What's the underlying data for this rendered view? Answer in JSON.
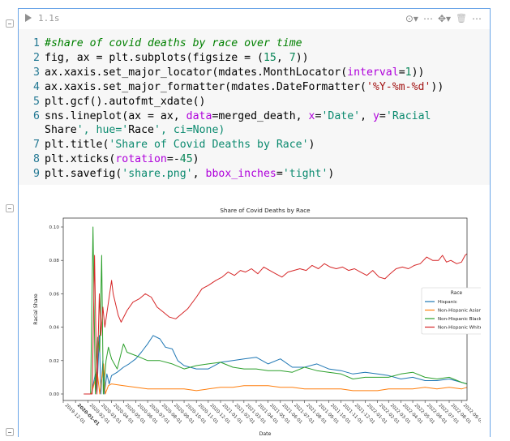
{
  "cell": {
    "execution_time": "1.1s",
    "toolbar_icons": [
      "eye-icon",
      "chevron-down-icon",
      "more-horizontal-icon",
      "puzzle-icon",
      "chevron-down-icon",
      "trash-icon",
      "more-vertical-icon"
    ],
    "toolbar": {
      "eye": "⊙▾",
      "more1": "⋯",
      "puzzle": "✥▾",
      "trash": "🗑",
      "more2": "⋯"
    }
  },
  "code": {
    "lines": [
      {
        "n": "1",
        "text": "#share of covid deaths by race over time"
      },
      {
        "n": "2",
        "text": "fig, ax = plt.subplots(figsize = (15, 7))"
      },
      {
        "n": "3",
        "text": "ax.xaxis.set_major_locator(mdates.MonthLocator(interval=1))"
      },
      {
        "n": "4",
        "text": "ax.xaxis.set_major_formatter(mdates.DateFormatter('%Y-%m-%d'))"
      },
      {
        "n": "5",
        "text": "plt.gcf().autofmt_xdate()"
      },
      {
        "n": "6",
        "text": "sns.lineplot(ax = ax, data=merged_death, x='Date', y='Racial"
      },
      {
        "n": "",
        "text": "Share', hue='Race', ci=None)"
      },
      {
        "n": "7",
        "text": "plt.title('Share of Covid Deaths by Race')"
      },
      {
        "n": "8",
        "text": "plt.xticks(rotation=-45)"
      },
      {
        "n": "9",
        "text": "plt.savefig('share.png', bbox_inches='tight')"
      }
    ]
  },
  "chart_data": {
    "type": "line",
    "title": "Share of Covid Deaths by Race",
    "xlabel": "Date",
    "ylabel": "Racial Share",
    "ylim": [
      0,
      0.1
    ],
    "yticks": [
      "0.00",
      "0.02",
      "0.04",
      "0.06",
      "0.08",
      "0.10"
    ],
    "ytick_values": [
      0,
      0.02,
      0.04,
      0.06,
      0.08,
      0.1
    ],
    "xlim": [
      "2019-12-01",
      "2022-09-15"
    ],
    "xticks": [
      "2019-12-01",
      "2020-01-01",
      "2020-02-01",
      "2020-03-01",
      "2020-04-01",
      "2020-05-01",
      "2020-06-01",
      "2020-07-01",
      "2020-08-01",
      "2020-09-01",
      "2020-10-01",
      "2020-11-01",
      "2020-12-01",
      "2021-01-01",
      "2021-02-01",
      "2021-03-01",
      "2021-04-01",
      "2021-05-01",
      "2021-06-01",
      "2021-07-01",
      "2021-08-01",
      "2021-09-01",
      "2021-10-01",
      "2021-11-01",
      "2021-12-01",
      "2022-01-01",
      "2022-02-01",
      "2022-03-01",
      "2022-04-01",
      "2022-05-01",
      "2022-06-01",
      "2022-07-01",
      "2022-08-01",
      "2022-09-01"
    ],
    "legend_title": "Race",
    "legend_position": "center-right",
    "series": [
      {
        "name": "Hispanic",
        "color": "#1f77b4",
        "points": [
          [
            "2020-01-22",
            0
          ],
          [
            "2020-02-10",
            0
          ],
          [
            "2020-02-20",
            0.012
          ],
          [
            "2020-02-24",
            0
          ],
          [
            "2020-03-01",
            0.035
          ],
          [
            "2020-03-05",
            0
          ],
          [
            "2020-03-10",
            0.02
          ],
          [
            "2020-03-14",
            0
          ],
          [
            "2020-03-20",
            0.012
          ],
          [
            "2020-03-26",
            0.006
          ],
          [
            "2020-04-01",
            0.011
          ],
          [
            "2020-04-15",
            0.013
          ],
          [
            "2020-05-01",
            0.016
          ],
          [
            "2020-05-15",
            0.018
          ],
          [
            "2020-06-01",
            0.021
          ],
          [
            "2020-06-15",
            0.025
          ],
          [
            "2020-07-01",
            0.03
          ],
          [
            "2020-07-15",
            0.035
          ],
          [
            "2020-08-01",
            0.033
          ],
          [
            "2020-08-15",
            0.028
          ],
          [
            "2020-09-01",
            0.027
          ],
          [
            "2020-09-15",
            0.02
          ],
          [
            "2020-10-01",
            0.017
          ],
          [
            "2020-11-01",
            0.015
          ],
          [
            "2020-12-01",
            0.015
          ],
          [
            "2021-01-01",
            0.019
          ],
          [
            "2021-02-01",
            0.02
          ],
          [
            "2021-03-01",
            0.021
          ],
          [
            "2021-04-01",
            0.022
          ],
          [
            "2021-05-01",
            0.018
          ],
          [
            "2021-06-01",
            0.021
          ],
          [
            "2021-07-01",
            0.016
          ],
          [
            "2021-08-01",
            0.016
          ],
          [
            "2021-09-01",
            0.018
          ],
          [
            "2021-10-01",
            0.015
          ],
          [
            "2021-11-01",
            0.014
          ],
          [
            "2021-12-01",
            0.012
          ],
          [
            "2022-01-01",
            0.013
          ],
          [
            "2022-02-01",
            0.012
          ],
          [
            "2022-03-01",
            0.011
          ],
          [
            "2022-04-01",
            0.009
          ],
          [
            "2022-05-01",
            0.01
          ],
          [
            "2022-06-01",
            0.008
          ],
          [
            "2022-07-01",
            0.008
          ],
          [
            "2022-08-01",
            0.009
          ],
          [
            "2022-09-01",
            0.007
          ],
          [
            "2022-09-15",
            0.006
          ]
        ]
      },
      {
        "name": "Non-Hispanic Asian",
        "color": "#ff7f0e",
        "points": [
          [
            "2020-01-22",
            0
          ],
          [
            "2020-02-10",
            0
          ],
          [
            "2020-02-25",
            0.013
          ],
          [
            "2020-03-02",
            0
          ],
          [
            "2020-03-12",
            0.018
          ],
          [
            "2020-03-16",
            0
          ],
          [
            "2020-03-24",
            0.005
          ],
          [
            "2020-04-01",
            0.006
          ],
          [
            "2020-05-01",
            0.005
          ],
          [
            "2020-06-01",
            0.004
          ],
          [
            "2020-07-01",
            0.003
          ],
          [
            "2020-08-01",
            0.003
          ],
          [
            "2020-09-01",
            0.003
          ],
          [
            "2020-10-01",
            0.003
          ],
          [
            "2020-11-01",
            0.002
          ],
          [
            "2020-12-01",
            0.003
          ],
          [
            "2021-01-01",
            0.004
          ],
          [
            "2021-02-01",
            0.004
          ],
          [
            "2021-03-01",
            0.005
          ],
          [
            "2021-04-01",
            0.005
          ],
          [
            "2021-05-01",
            0.005
          ],
          [
            "2021-06-01",
            0.004
          ],
          [
            "2021-07-01",
            0.004
          ],
          [
            "2021-08-01",
            0.003
          ],
          [
            "2021-09-01",
            0.003
          ],
          [
            "2021-10-01",
            0.003
          ],
          [
            "2021-11-01",
            0.003
          ],
          [
            "2021-12-01",
            0.002
          ],
          [
            "2022-01-01",
            0.002
          ],
          [
            "2022-02-01",
            0.002
          ],
          [
            "2022-03-01",
            0.003
          ],
          [
            "2022-04-01",
            0.003
          ],
          [
            "2022-05-01",
            0.003
          ],
          [
            "2022-06-01",
            0.004
          ],
          [
            "2022-07-01",
            0.003
          ],
          [
            "2022-08-01",
            0.004
          ],
          [
            "2022-09-01",
            0.003
          ],
          [
            "2022-09-15",
            0.004
          ]
        ]
      },
      {
        "name": "Non-Hispanic Black",
        "color": "#2ca02c",
        "points": [
          [
            "2020-01-22",
            0
          ],
          [
            "2020-02-08",
            0
          ],
          [
            "2020-02-14",
            0.1
          ],
          [
            "2020-02-20",
            0
          ],
          [
            "2020-02-26",
            0.034
          ],
          [
            "2020-03-02",
            0.025
          ],
          [
            "2020-03-07",
            0.083
          ],
          [
            "2020-03-11",
            0
          ],
          [
            "2020-03-18",
            0.02
          ],
          [
            "2020-03-24",
            0.028
          ],
          [
            "2020-04-01",
            0.021
          ],
          [
            "2020-04-15",
            0.015
          ],
          [
            "2020-05-01",
            0.03
          ],
          [
            "2020-05-10",
            0.025
          ],
          [
            "2020-06-01",
            0.023
          ],
          [
            "2020-07-01",
            0.02
          ],
          [
            "2020-08-01",
            0.02
          ],
          [
            "2020-09-01",
            0.018
          ],
          [
            "2020-10-01",
            0.015
          ],
          [
            "2020-11-01",
            0.017
          ],
          [
            "2020-12-01",
            0.018
          ],
          [
            "2021-01-01",
            0.019
          ],
          [
            "2021-02-01",
            0.016
          ],
          [
            "2021-03-01",
            0.015
          ],
          [
            "2021-04-01",
            0.015
          ],
          [
            "2021-05-01",
            0.014
          ],
          [
            "2021-06-01",
            0.014
          ],
          [
            "2021-07-01",
            0.013
          ],
          [
            "2021-08-01",
            0.016
          ],
          [
            "2021-09-01",
            0.014
          ],
          [
            "2021-10-01",
            0.013
          ],
          [
            "2021-11-01",
            0.012
          ],
          [
            "2021-12-01",
            0.009
          ],
          [
            "2022-01-01",
            0.01
          ],
          [
            "2022-02-01",
            0.01
          ],
          [
            "2022-03-01",
            0.01
          ],
          [
            "2022-04-01",
            0.012
          ],
          [
            "2022-05-01",
            0.013
          ],
          [
            "2022-06-01",
            0.01
          ],
          [
            "2022-07-01",
            0.009
          ],
          [
            "2022-08-01",
            0.01
          ],
          [
            "2022-09-01",
            0.007
          ],
          [
            "2022-09-15",
            0.006
          ]
        ]
      },
      {
        "name": "Non-Hispanic White",
        "color": "#d62728",
        "points": [
          [
            "2020-01-22",
            0
          ],
          [
            "2020-02-12",
            0
          ],
          [
            "2020-02-18",
            0.083
          ],
          [
            "2020-02-24",
            0
          ],
          [
            "2020-03-01",
            0.06
          ],
          [
            "2020-03-05",
            0.035
          ],
          [
            "2020-03-10",
            0.052
          ],
          [
            "2020-03-15",
            0.04
          ],
          [
            "2020-04-01",
            0.068
          ],
          [
            "2020-04-05",
            0.06
          ],
          [
            "2020-04-18",
            0.047
          ],
          [
            "2020-04-25",
            0.043
          ],
          [
            "2020-05-10",
            0.05
          ],
          [
            "2020-05-25",
            0.055
          ],
          [
            "2020-06-10",
            0.057
          ],
          [
            "2020-06-25",
            0.06
          ],
          [
            "2020-07-10",
            0.058
          ],
          [
            "2020-07-25",
            0.052
          ],
          [
            "2020-08-10",
            0.049
          ],
          [
            "2020-08-25",
            0.046
          ],
          [
            "2020-09-10",
            0.045
          ],
          [
            "2020-09-25",
            0.048
          ],
          [
            "2020-10-10",
            0.051
          ],
          [
            "2020-11-01",
            0.058
          ],
          [
            "2020-11-15",
            0.063
          ],
          [
            "2020-12-01",
            0.065
          ],
          [
            "2020-12-20",
            0.068
          ],
          [
            "2021-01-05",
            0.07
          ],
          [
            "2021-01-20",
            0.073
          ],
          [
            "2021-02-05",
            0.071
          ],
          [
            "2021-02-20",
            0.074
          ],
          [
            "2021-03-05",
            0.073
          ],
          [
            "2021-03-20",
            0.075
          ],
          [
            "2021-04-05",
            0.072
          ],
          [
            "2021-04-20",
            0.076
          ],
          [
            "2021-05-05",
            0.074
          ],
          [
            "2021-05-20",
            0.072
          ],
          [
            "2021-06-05",
            0.07
          ],
          [
            "2021-06-20",
            0.073
          ],
          [
            "2021-07-05",
            0.074
          ],
          [
            "2021-07-20",
            0.075
          ],
          [
            "2021-08-05",
            0.074
          ],
          [
            "2021-08-20",
            0.077
          ],
          [
            "2021-09-05",
            0.075
          ],
          [
            "2021-09-20",
            0.078
          ],
          [
            "2021-10-05",
            0.076
          ],
          [
            "2021-10-20",
            0.075
          ],
          [
            "2021-11-05",
            0.076
          ],
          [
            "2021-11-20",
            0.074
          ],
          [
            "2021-12-05",
            0.075
          ],
          [
            "2021-12-20",
            0.073
          ],
          [
            "2022-01-05",
            0.071
          ],
          [
            "2022-01-20",
            0.074
          ],
          [
            "2022-02-05",
            0.07
          ],
          [
            "2022-02-20",
            0.069
          ],
          [
            "2022-03-05",
            0.072
          ],
          [
            "2022-03-20",
            0.075
          ],
          [
            "2022-04-05",
            0.076
          ],
          [
            "2022-04-20",
            0.075
          ],
          [
            "2022-05-05",
            0.077
          ],
          [
            "2022-05-20",
            0.078
          ],
          [
            "2022-06-05",
            0.082
          ],
          [
            "2022-06-20",
            0.08
          ],
          [
            "2022-07-05",
            0.08
          ],
          [
            "2022-07-15",
            0.083
          ],
          [
            "2022-07-25",
            0.079
          ],
          [
            "2022-08-05",
            0.08
          ],
          [
            "2022-08-20",
            0.078
          ],
          [
            "2022-09-01",
            0.079
          ],
          [
            "2022-09-10",
            0.083
          ],
          [
            "2022-09-15",
            0.084
          ]
        ]
      }
    ]
  }
}
